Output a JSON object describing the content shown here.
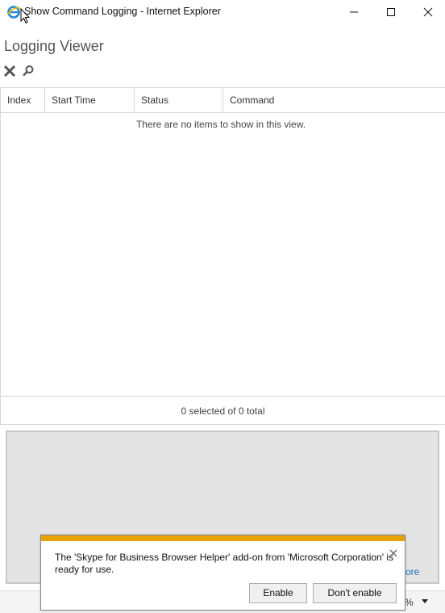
{
  "window": {
    "title": "Show Command Logging - Internet Explorer"
  },
  "page": {
    "title": "Logging Viewer"
  },
  "toolbar": {
    "icons": [
      "clear-icon",
      "search-icon"
    ]
  },
  "grid": {
    "columns": [
      "Index",
      "Start Time",
      "Status",
      "Command"
    ],
    "empty_message": "There are no items to show in this view.",
    "footer": "0 selected of 0 total"
  },
  "detail": {
    "link_partial": "ore"
  },
  "statusbar": {
    "zoom_partial": "%"
  },
  "notification": {
    "message": "The 'Skype for Business Browser Helper' add-on from 'Microsoft Corporation' is ready for use.",
    "enable_label": "Enable",
    "dont_enable_label": "Don't enable",
    "accent_color": "#e8a200"
  }
}
